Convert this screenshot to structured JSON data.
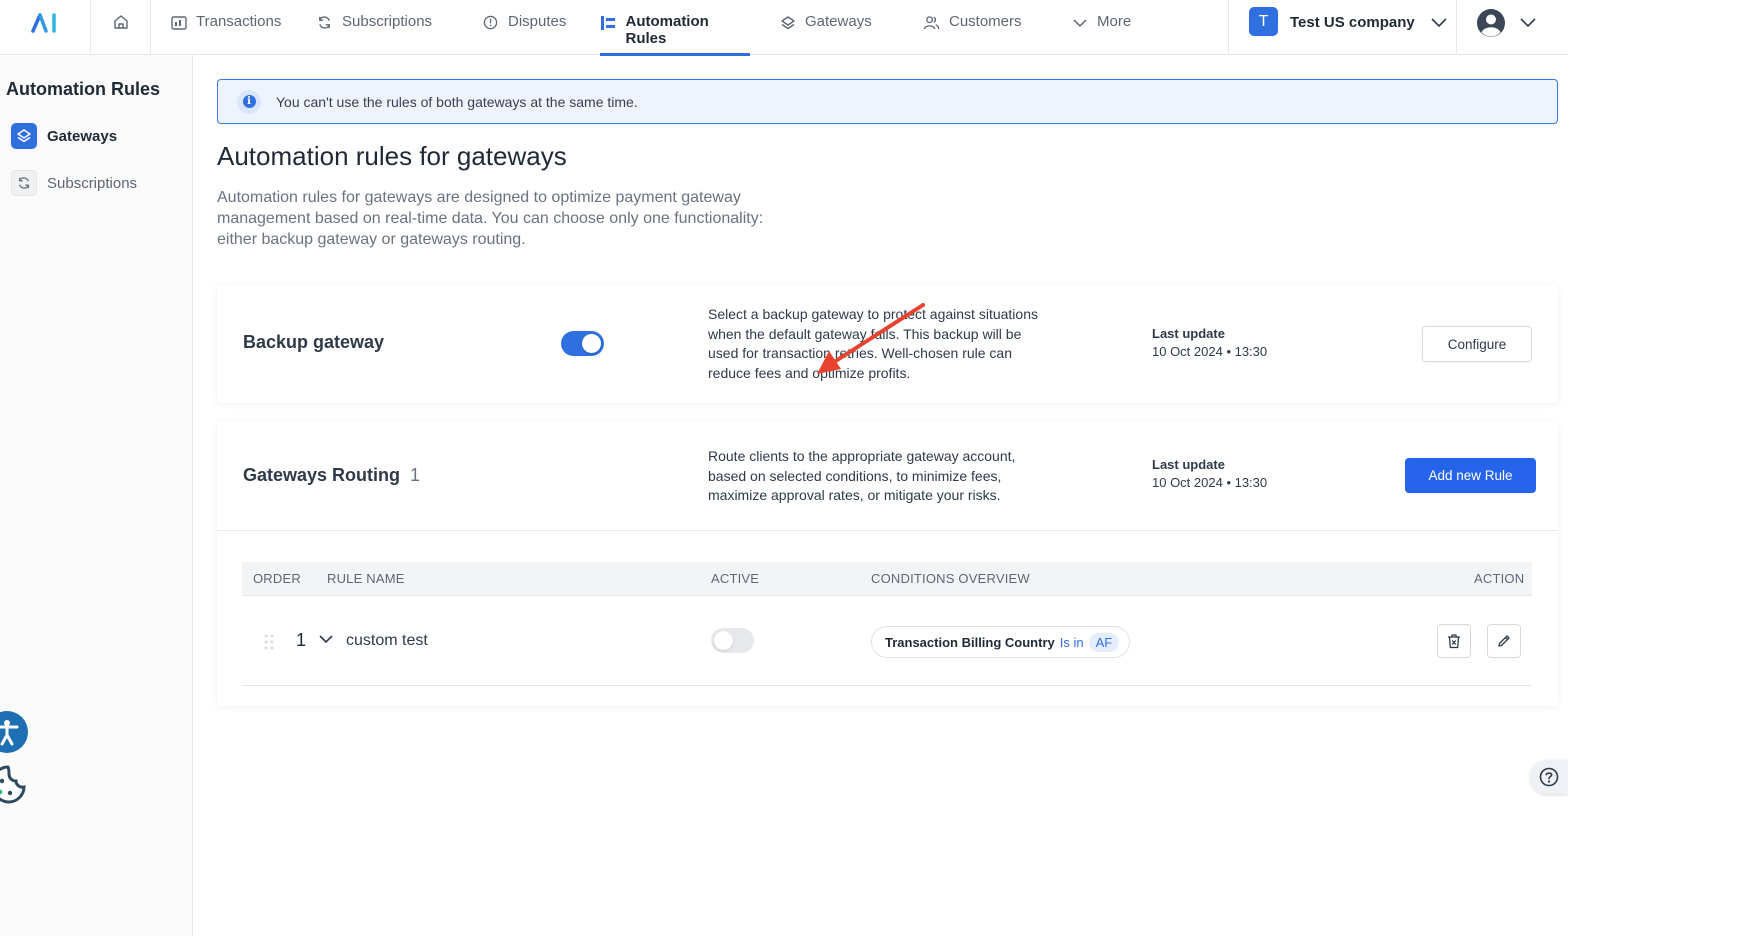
{
  "nav": {
    "tabs": [
      {
        "label": "Transactions",
        "icon": "dashboard-icon"
      },
      {
        "label": "Subscriptions",
        "icon": "refresh-icon"
      },
      {
        "label": "Disputes",
        "icon": "alert-circle-icon"
      },
      {
        "label": "Automation Rules",
        "icon": "automation-icon",
        "active": true
      },
      {
        "label": "Gateways",
        "icon": "layers-icon"
      },
      {
        "label": "Customers",
        "icon": "users-icon"
      },
      {
        "label": "More",
        "icon": "chevron-down-icon"
      }
    ],
    "company": {
      "badge": "T",
      "name": "Test US company"
    }
  },
  "sidebar": {
    "title": "Automation Rules",
    "items": [
      {
        "label": "Gateways",
        "active": true
      },
      {
        "label": "Subscriptions",
        "active": false
      }
    ]
  },
  "main": {
    "alert": "You can't use the rules of both gateways at the same time.",
    "title": "Automation rules for gateways",
    "description": "Automation rules for gateways are designed to optimize payment gateway management based on real-time data. You can choose only one functionality: either backup gateway or gateways routing."
  },
  "backup": {
    "title": "Backup gateway",
    "enabled": true,
    "description": "Select a backup gateway to protect against situations when the default gateway fails. This backup will be used for transaction retries. Well-chosen rule can reduce fees and optimize profits.",
    "last_update_label": "Last update",
    "last_update_value": "10 Oct 2024 • 13:30",
    "button": "Configure"
  },
  "routing": {
    "title": "Gateways Routing",
    "count": "1",
    "description": "Route clients to the appropriate gateway account, based on selected conditions, to minimize fees, maximize approval rates, or mitigate your risks.",
    "last_update_label": "Last update",
    "last_update_value": "10 Oct 2024 • 13:30",
    "button": "Add new Rule",
    "table": {
      "headers": {
        "order": "ORDER",
        "rule_name": "RULE NAME",
        "active": "ACTIVE",
        "conditions": "CONDITIONS OVERVIEW",
        "action": "ACTION"
      },
      "rows": [
        {
          "order": "1",
          "name": "custom test",
          "active": false,
          "condition_field": "Transaction Billing Country",
          "condition_operator": "Is in",
          "condition_value": "AF"
        }
      ]
    }
  },
  "colors": {
    "accent": "#2f6fe0",
    "primary_button": "#2563eb",
    "annotation_arrow": "#e8432e"
  }
}
